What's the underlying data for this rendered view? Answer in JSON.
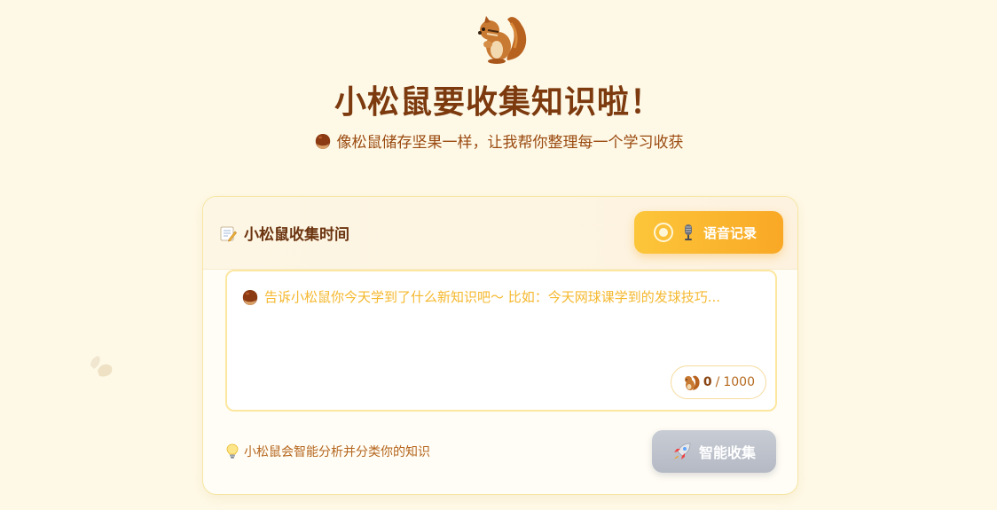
{
  "header": {
    "title": "小松鼠要收集知识啦！",
    "subtitle": "像松鼠储存坚果一样，让我帮你整理每一个学习收获"
  },
  "card": {
    "title": "小松鼠收集时间",
    "voice_button_label": "语音记录",
    "input": {
      "value": "",
      "placeholder": "告诉小松鼠你今天学到了什么新知识吧～ 比如：今天网球课学到的发球技巧..."
    },
    "counter": {
      "current": "0",
      "separator": "/",
      "max": "1000"
    },
    "hint": "小松鼠会智能分析并分类你的知识",
    "collect_button_label": "智能收集"
  },
  "icons": {
    "mascot": "squirrel-icon",
    "subtitle": "chestnut-icon",
    "card_title": "memo-icon",
    "voice_record": "record-icon",
    "voice_mic": "microphone-icon",
    "placeholder": "chestnut-icon",
    "counter": "squirrel-icon",
    "hint": "lightbulb-icon",
    "collect": "rocket-icon",
    "decoration": "leaf-icon"
  },
  "colors": {
    "background": "#fef9e7",
    "title": "#7c3a0e",
    "accent": "#f9a825",
    "placeholder": "#f5b82e",
    "disabled_button": "#b4b9c4"
  }
}
